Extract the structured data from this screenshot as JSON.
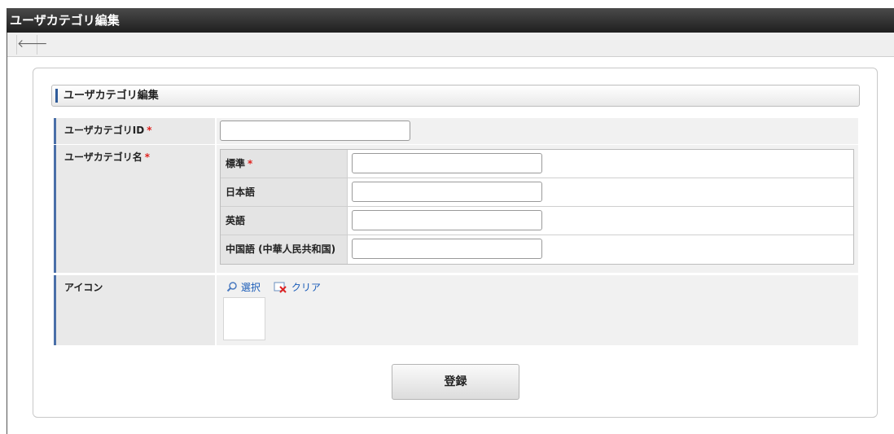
{
  "window": {
    "title": "ユーザカテゴリ編集"
  },
  "toolbar": {
    "back_icon": "back-arrow-icon",
    "back_glyph": "🡐"
  },
  "section": {
    "title": "ユーザカテゴリ編集"
  },
  "form": {
    "category_id": {
      "label": "ユーザカテゴリID",
      "required_mark": "*",
      "value": ""
    },
    "category_name": {
      "label": "ユーザカテゴリ名",
      "required_mark": "*",
      "languages": [
        {
          "label": "標準",
          "required_mark": "*",
          "value": ""
        },
        {
          "label": "日本語",
          "required_mark": "",
          "value": ""
        },
        {
          "label": "英語",
          "required_mark": "",
          "value": ""
        },
        {
          "label": "中国語 (中華人民共和国)",
          "required_mark": "",
          "value": ""
        }
      ]
    },
    "icon": {
      "label": "アイコン",
      "select_label": "選択",
      "clear_label": "クリア"
    }
  },
  "actions": {
    "submit_label": "登録"
  },
  "colors": {
    "required": "#e0231f",
    "link": "#1a5cb8",
    "accent_bar": "#4a6fa8"
  }
}
